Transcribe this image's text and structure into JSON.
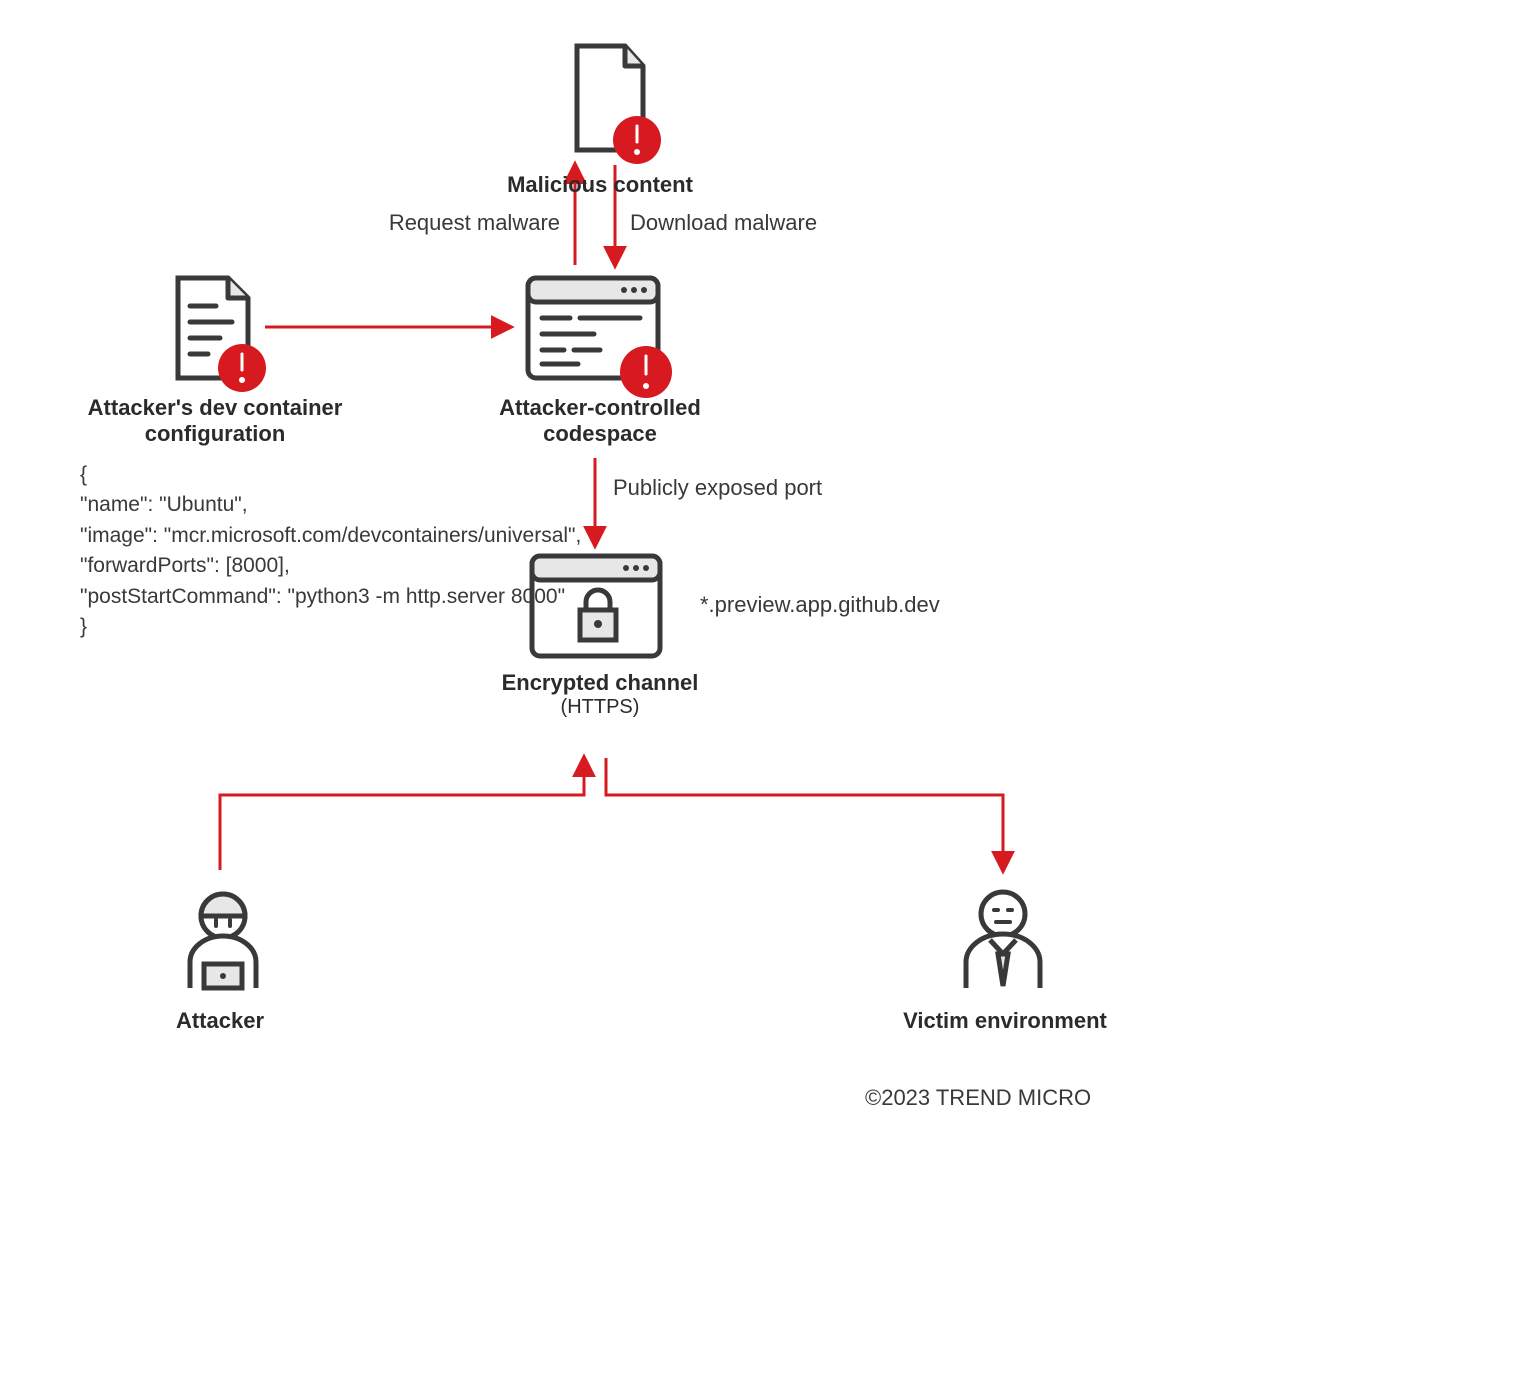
{
  "nodes": {
    "malicious_content": {
      "label": "Malicious content"
    },
    "dev_container": {
      "label_line1": "Attacker's dev container",
      "label_line2": "configuration"
    },
    "codespace": {
      "label_line1": "Attacker-controlled",
      "label_line2": "codespace"
    },
    "encrypted": {
      "label": "Encrypted channel",
      "sub": "(HTTPS)"
    },
    "attacker": {
      "label": "Attacker"
    },
    "victim": {
      "label": "Victim environment"
    }
  },
  "edges": {
    "request_malware": "Request malware",
    "download_malware": "Download malware",
    "exposed_port": "Publicly exposed port",
    "preview_domain": "*.preview.app.github.dev"
  },
  "code": "{\n\"name\": \"Ubuntu\",\n\"image\": \"mcr.microsoft.com/devcontainers/universal\",\n\"forwardPorts\": [8000],\n\"postStartCommand\": \"python3 -m http.server 8000\"\n}",
  "copyright": "©2023 TREND MICRO"
}
